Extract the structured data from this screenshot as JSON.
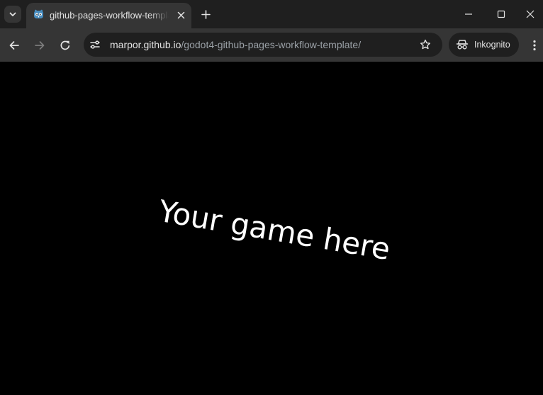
{
  "tab": {
    "title": "github-pages-workflow-template",
    "favicon": "godot-icon"
  },
  "address_bar": {
    "host": "marpor.github.io",
    "path": "/godot4-github-pages-workflow-template/"
  },
  "incognito": {
    "label": "Inkognito"
  },
  "page": {
    "game_text": "Your game here"
  },
  "icons": {
    "tab_search": "chevron-down-icon",
    "tab_close": "close-icon",
    "new_tab": "plus-icon",
    "minimize": "minimize-icon",
    "maximize": "maximize-icon",
    "close": "close-icon",
    "back": "arrow-left-icon",
    "forward": "arrow-right-icon",
    "reload": "reload-icon",
    "site_info": "tune-icon",
    "bookmark": "star-icon",
    "incognito": "incognito-icon",
    "menu": "more-vert-icon"
  },
  "colors": {
    "tabstrip_bg": "#1f1f1f",
    "toolbar_bg": "#353535",
    "omnibox_bg": "#1f1f1f",
    "page_bg": "#000000",
    "text_primary": "#e3e3e3",
    "text_secondary": "#9aa0a6",
    "game_text": "#ffffff"
  }
}
